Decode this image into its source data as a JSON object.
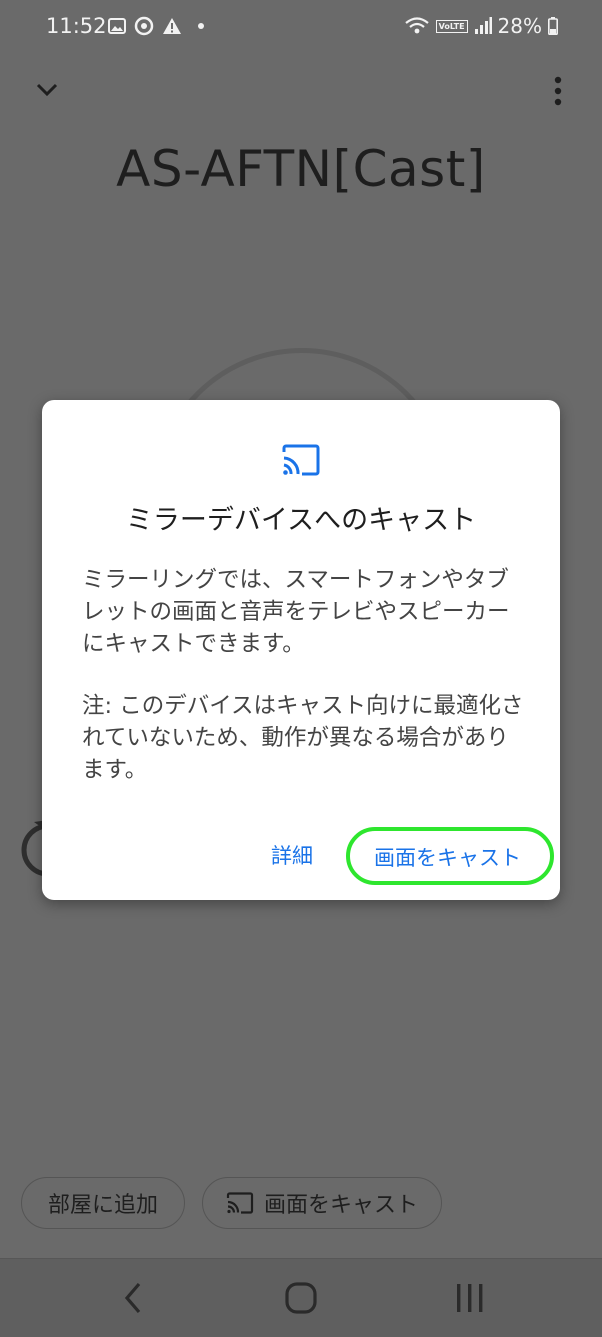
{
  "status_bar": {
    "time": "11:52",
    "battery": "28%",
    "network_badge": "VoLTE"
  },
  "device": {
    "title": "AS-AFTN[Cast]"
  },
  "dialog": {
    "title": "ミラーデバイスへのキャスト",
    "body_1": "ミラーリングでは、スマートフォンやタブレットの画面と音声をテレビやスピーカーにキャストできます。",
    "body_2": "注: このデバイスはキャスト向けに最適化されていないため、動作が異なる場合があります。",
    "details_label": "詳細",
    "cast_label": "画面をキャスト"
  },
  "chips": {
    "add_to_room": "部屋に追加",
    "cast_screen": "画面をキャスト"
  },
  "icons": {
    "collapse": "chevron-down-icon",
    "more": "more-vert-icon",
    "cast": "cast-icon",
    "back": "nav-back-icon",
    "home": "nav-home-icon",
    "recents": "nav-recents-icon"
  },
  "colors": {
    "accent": "#1a73e8",
    "highlight": "#2ee62e",
    "scrim": "#6a6a6a"
  }
}
